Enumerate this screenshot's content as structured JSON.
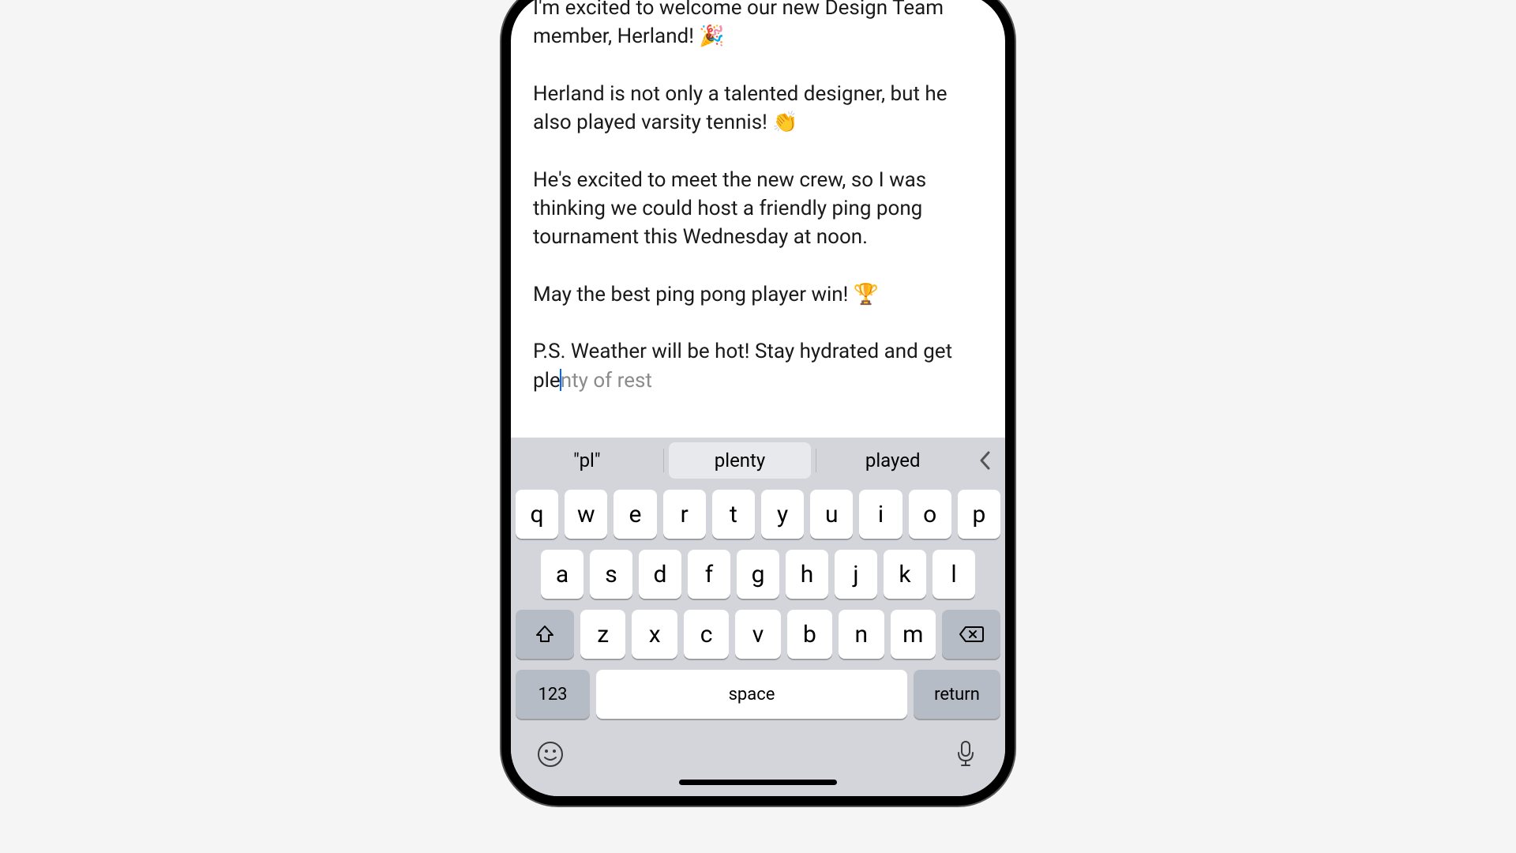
{
  "message": {
    "p1": "I'm excited to welcome our new Design Team member, Herland! 🎉",
    "p2": "Herland is not only a talented designer, but he also played varsity tennis! 👏",
    "p3": "He's excited to meet the new crew, so I was thinking we could host a friendly ping pong tournament this Wednesday at noon.",
    "p4": "May the best ping pong player win! 🏆",
    "p5_typed": "P.S. Weather will be hot! Stay hydrated and get ple",
    "p5_predicted": "nty of rest"
  },
  "predictions": {
    "opt1": "\"pl\"",
    "opt2": "plenty",
    "opt3": "played"
  },
  "keyboard": {
    "row1": [
      "q",
      "w",
      "e",
      "r",
      "t",
      "y",
      "u",
      "i",
      "o",
      "p"
    ],
    "row2": [
      "a",
      "s",
      "d",
      "f",
      "g",
      "h",
      "j",
      "k",
      "l"
    ],
    "row3": [
      "z",
      "x",
      "c",
      "v",
      "b",
      "n",
      "m"
    ],
    "numbers": "123",
    "space": "space",
    "return": "return"
  }
}
